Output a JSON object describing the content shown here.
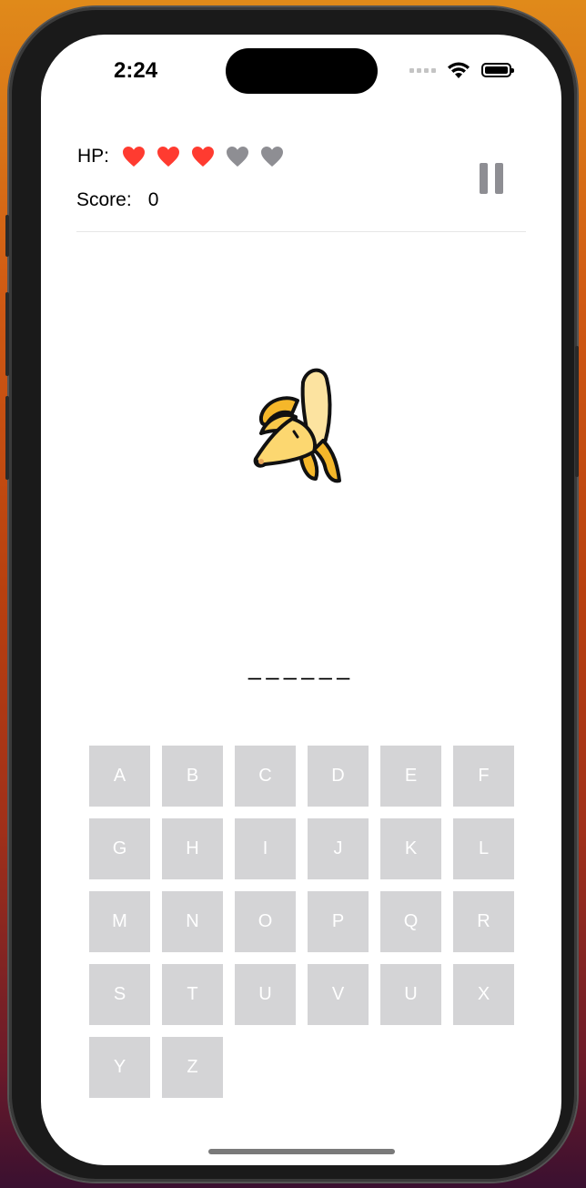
{
  "status_bar": {
    "time": "2:24"
  },
  "hud": {
    "hp_label": "HP:",
    "hp_max": 5,
    "hp_current": 3,
    "hp_full_color": "#ff3b30",
    "hp_empty_color": "#8e8e93",
    "score_label": "Score:",
    "score_value": "0"
  },
  "puzzle": {
    "image": "banana-icon",
    "word_mask": "––––––"
  },
  "keyboard": {
    "keys": [
      "A",
      "B",
      "C",
      "D",
      "E",
      "F",
      "G",
      "H",
      "I",
      "J",
      "K",
      "L",
      "M",
      "N",
      "O",
      "P",
      "Q",
      "R",
      "S",
      "T",
      "U",
      "V",
      "U",
      "X",
      "Y",
      "Z"
    ]
  },
  "colors": {
    "key_bg": "#d4d4d6",
    "key_text": "#ffffff"
  }
}
